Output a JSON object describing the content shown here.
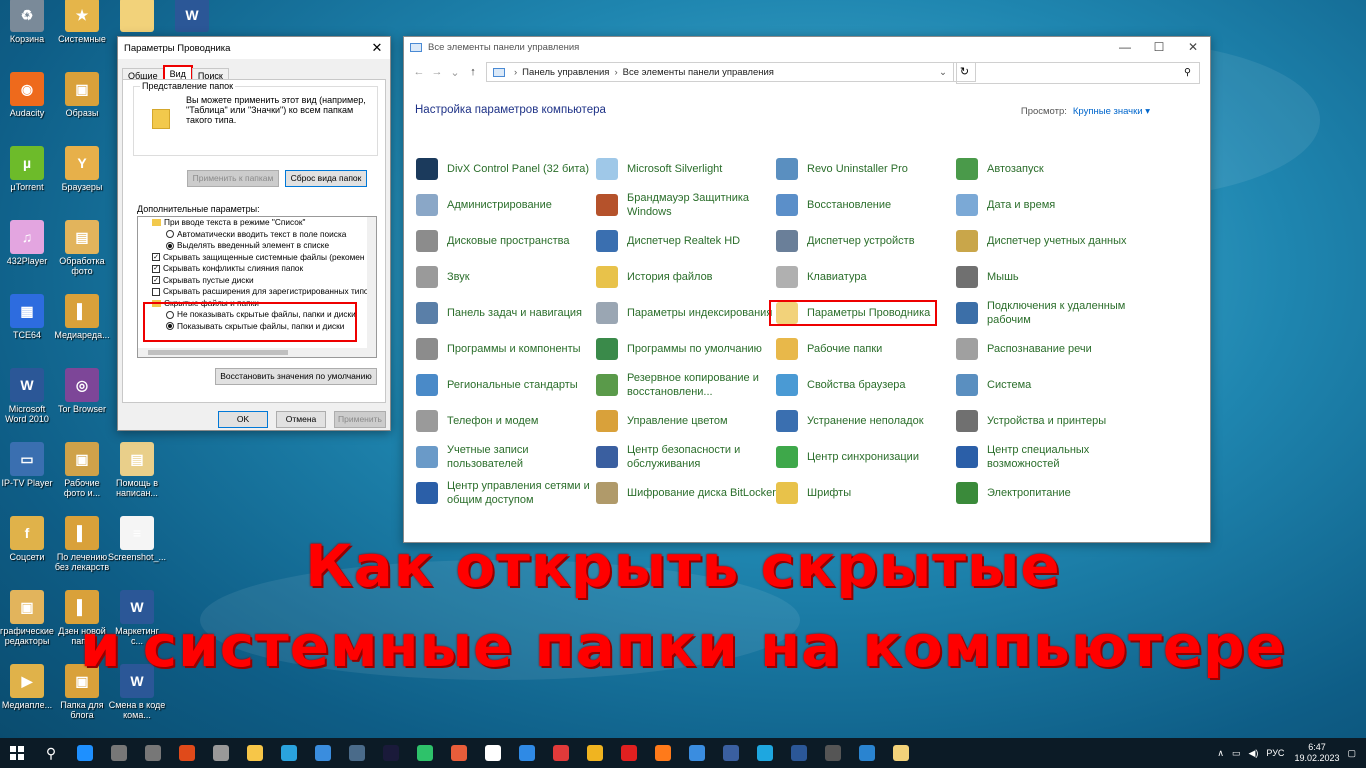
{
  "desktop": {
    "icons": [
      {
        "label": "Корзина",
        "color": "#7a8a99",
        "glyph": "♻"
      },
      {
        "label": "Системные",
        "color": "#e5b54a",
        "glyph": "★"
      },
      {
        "label": "",
        "color": "#f2d27a",
        "glyph": ""
      },
      {
        "label": "",
        "color": "#2b5797",
        "glyph": "W"
      },
      {
        "label": "Audacity",
        "color": "#ee6a1c",
        "glyph": "◉"
      },
      {
        "label": "Образы",
        "color": "#d9a13a",
        "glyph": "▣"
      },
      {
        "label": "µTorrent",
        "color": "#6dbb2a",
        "glyph": "µ"
      },
      {
        "label": "Браузеры",
        "color": "#e7b04a",
        "glyph": "Y"
      },
      {
        "label": "432Player",
        "color": "#e3a5e0",
        "glyph": "♫"
      },
      {
        "label": "Обработка фото",
        "color": "#e2b45c",
        "glyph": "▤"
      },
      {
        "label": "TCE64",
        "color": "#2d6cdf",
        "glyph": "▦"
      },
      {
        "label": "Медиаредa...",
        "color": "#d9a13a",
        "glyph": "▌"
      },
      {
        "label": "Microsoft Word 2010",
        "color": "#2b5797",
        "glyph": "W"
      },
      {
        "label": "Tor Browser",
        "color": "#7d4698",
        "glyph": "◎"
      },
      {
        "label": "IP-TV Player",
        "color": "#3a6fb0",
        "glyph": "▭"
      },
      {
        "label": "Рабочие фото и...",
        "color": "#cfa24a",
        "glyph": "▣"
      },
      {
        "label": "Помощь в написан...",
        "color": "#e9cf8a",
        "glyph": "▤"
      },
      {
        "label": "Соцсети",
        "color": "#e0b24a",
        "glyph": "f"
      },
      {
        "label": "По лечению без лекарств",
        "color": "#d9a13a",
        "glyph": "▌"
      },
      {
        "label": "Screenshot_...",
        "color": "#f5f5f5",
        "glyph": "≡"
      },
      {
        "label": "графические редакторы",
        "color": "#e2b45c",
        "glyph": "▣"
      },
      {
        "label": "Дзен новой папы",
        "color": "#d9a13a",
        "glyph": "▌"
      },
      {
        "label": "Маркетинг с...",
        "color": "#2b5797",
        "glyph": "W"
      },
      {
        "label": "Медиапле...",
        "color": "#e0b24a",
        "glyph": "▶"
      },
      {
        "label": "Папка для блога",
        "color": "#d9a13a",
        "glyph": "▣"
      },
      {
        "label": "Смена в коде кома...",
        "color": "#2b5797",
        "glyph": "W"
      }
    ]
  },
  "folder_options": {
    "title": "Параметры Проводника",
    "tabs": [
      "Общие",
      "Вид",
      "Поиск"
    ],
    "group_label": "Представление папок",
    "group_text": "Вы можете применить этот вид (например, \"Таблица\" или \"Значки\") ко всем папкам такого типа.",
    "apply_to_folders": "Применить к папкам",
    "reset_folders": "Сброс вида папок",
    "advanced_label": "Дополнительные параметры:",
    "tree": [
      {
        "type": "folder",
        "text": "При вводе текста в режиме \"Список\"",
        "indent": 1
      },
      {
        "type": "radio",
        "checked": false,
        "text": "Автоматически вводить текст в поле поиска",
        "indent": 2
      },
      {
        "type": "radio",
        "checked": true,
        "text": "Выделять введенный элемент в списке",
        "indent": 2
      },
      {
        "type": "check",
        "checked": true,
        "text": "Скрывать защищенные системные файлы (рекомен",
        "indent": 1
      },
      {
        "type": "check",
        "checked": true,
        "text": "Скрывать конфликты слияния папок",
        "indent": 1
      },
      {
        "type": "check",
        "checked": true,
        "text": "Скрывать пустые диски",
        "indent": 1
      },
      {
        "type": "check",
        "checked": false,
        "text": "Скрывать расширения для зарегистрированных типо",
        "indent": 1
      },
      {
        "type": "folder",
        "text": "Скрытые файлы и папки",
        "indent": 1
      },
      {
        "type": "radio",
        "checked": false,
        "text": "Не показывать скрытые файлы, папки и диски",
        "indent": 2
      },
      {
        "type": "radio",
        "checked": true,
        "text": "Показывать скрытые файлы, папки и диски",
        "indent": 2
      }
    ],
    "restore_defaults": "Восстановить значения по умолчанию",
    "ok": "OK",
    "cancel": "Отмена",
    "apply": "Применить"
  },
  "control_panel": {
    "title": "Все элементы панели управления",
    "breadcrumb": [
      "Панель управления",
      "Все элементы панели управления"
    ],
    "heading": "Настройка параметров компьютера",
    "view_label": "Просмотр:",
    "view_value": "Крупные значки ▾",
    "items": [
      {
        "label": "DivX Control Panel (32 бита)",
        "color": "#1b3a5c"
      },
      {
        "label": "Microsoft Silverlight",
        "color": "#9fc8e8"
      },
      {
        "label": "Revo Uninstaller Pro",
        "color": "#5a8fc0"
      },
      {
        "label": "Автозапуск",
        "color": "#4a9a4a"
      },
      {
        "label": "Администрирование",
        "color": "#8aa7c7"
      },
      {
        "label": "Брандмауэр Защитника Windows",
        "color": "#b5522b"
      },
      {
        "label": "Восстановление",
        "color": "#5b8fc9"
      },
      {
        "label": "Дата и время",
        "color": "#7ba9d6"
      },
      {
        "label": "Дисковые пространства",
        "color": "#8c8c8c"
      },
      {
        "label": "Диспетчер Realtek HD",
        "color": "#3a6fb0"
      },
      {
        "label": "Диспетчер устройств",
        "color": "#6a7f99"
      },
      {
        "label": "Диспетчер учетных данных",
        "color": "#c9a64a"
      },
      {
        "label": "Звук",
        "color": "#9a9a9a"
      },
      {
        "label": "История файлов",
        "color": "#e8c24a"
      },
      {
        "label": "Клавиатура",
        "color": "#b0b0b0"
      },
      {
        "label": "Мышь",
        "color": "#707070"
      },
      {
        "label": "Панель задач и навигация",
        "color": "#5a7fa8"
      },
      {
        "label": "Параметры индексирования",
        "color": "#9aa6b3"
      },
      {
        "label": "Параметры Проводника",
        "color": "#f2d27a",
        "highlight": true
      },
      {
        "label": "Подключения к удаленным рабочим",
        "color": "#3c6fa8"
      },
      {
        "label": "Программы и компоненты",
        "color": "#8c8c8c"
      },
      {
        "label": "Программы по умолчанию",
        "color": "#3a8a4a"
      },
      {
        "label": "Рабочие папки",
        "color": "#e8b84a"
      },
      {
        "label": "Распознавание речи",
        "color": "#a0a0a0"
      },
      {
        "label": "Региональные стандарты",
        "color": "#4a8ac8"
      },
      {
        "label": "Резервное копирование и восстановлени...",
        "color": "#5a9a4a"
      },
      {
        "label": "Свойства браузера",
        "color": "#4a9ad4"
      },
      {
        "label": "Система",
        "color": "#5a8fc0"
      },
      {
        "label": "Телефон и модем",
        "color": "#9a9a9a"
      },
      {
        "label": "Управление цветом",
        "color": "#d9a13a"
      },
      {
        "label": "Устранение неполадок",
        "color": "#3a6fb0"
      },
      {
        "label": "Устройства и принтеры",
        "color": "#707070"
      },
      {
        "label": "Учетные записи пользователей",
        "color": "#6a9ac8"
      },
      {
        "label": "Центр безопасности и обслуживания",
        "color": "#3a5fa0"
      },
      {
        "label": "Центр синхронизации",
        "color": "#3ea84a"
      },
      {
        "label": "Центр специальных возможностей",
        "color": "#2b5fa8"
      },
      {
        "label": "Центр управления сетями и общим доступом",
        "color": "#2b5fa8"
      },
      {
        "label": "Шифрование диска BitLocker",
        "color": "#b09a6a"
      },
      {
        "label": "Шрифты",
        "color": "#e8c24a"
      },
      {
        "label": "Электропитание",
        "color": "#3a8a3a"
      }
    ]
  },
  "overlay": {
    "line1": "Как открыть скрытые",
    "line2": "и системные папки на компьютере"
  },
  "taskbar": {
    "apps": [
      "#1e90ff",
      "#777",
      "#777",
      "#e04a1a",
      "#999",
      "#f7c648",
      "#2aa3de",
      "#3a8dde",
      "#4a6b8a",
      "#1a1a3a",
      "#2ec26a",
      "#e85d3a",
      "#ffffff",
      "#2f8ae5",
      "#e03a3a",
      "#f0b420",
      "#e02020",
      "#ff7a1a",
      "#3a8de0",
      "#3a5fa0",
      "#1ea7e0",
      "#2b5797",
      "#555",
      "#2a84d0",
      "#f2d27a"
    ],
    "lang": "РУС",
    "time": "6:47",
    "date": "19.02.2023"
  }
}
